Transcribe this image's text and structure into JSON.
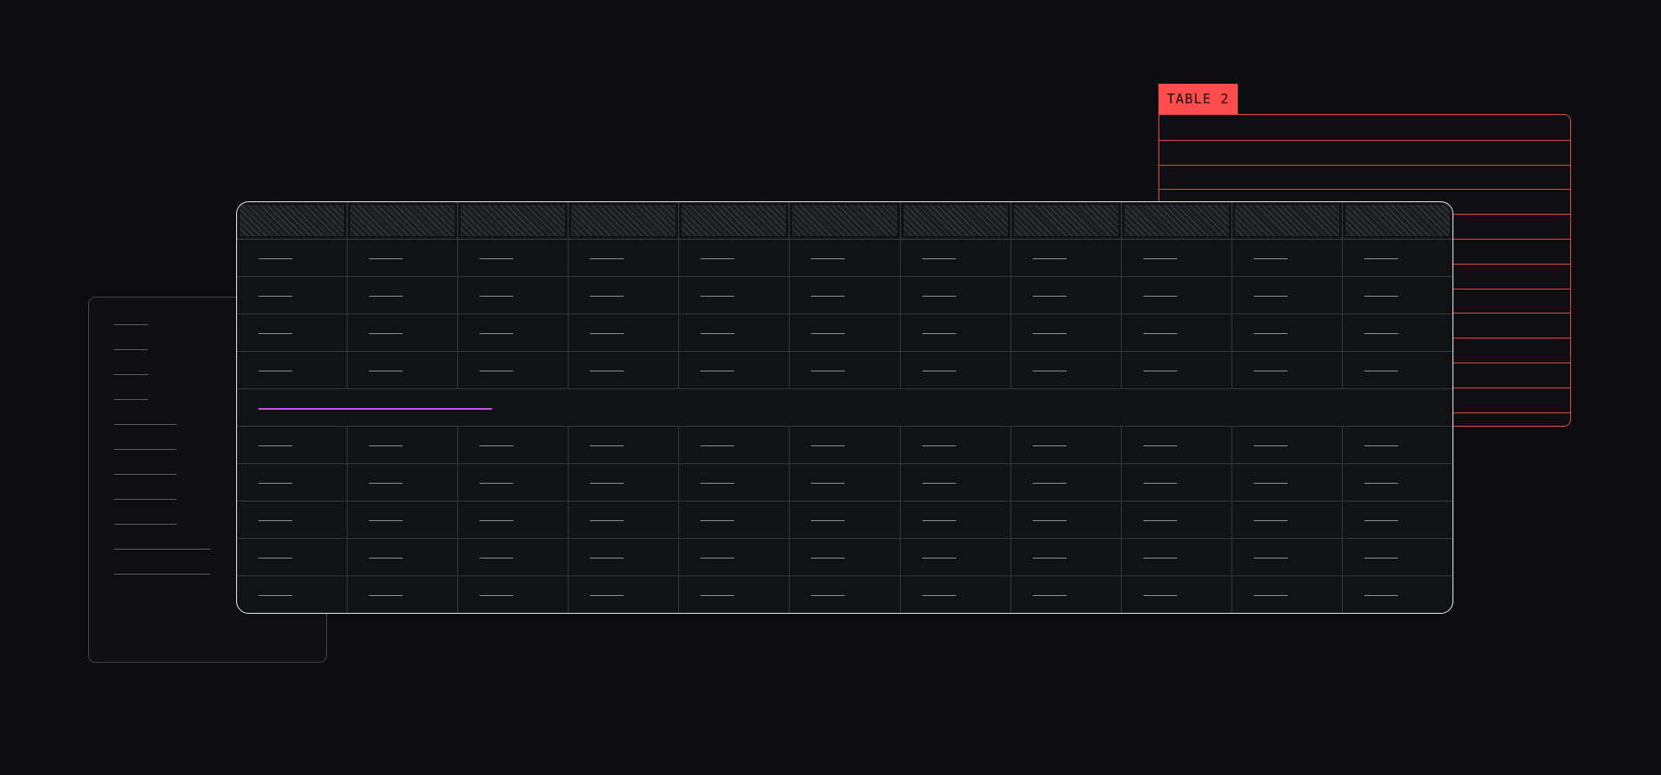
{
  "table2": {
    "label": "TABLE 2",
    "accent": "#ff4d4d",
    "row_count": 12
  },
  "main_table": {
    "columns": 11,
    "header_style": "hatched",
    "rows_before_group": 4,
    "rows_after_group": 5,
    "group_highlight_color": "#c94fe0",
    "border_color": "#e6e6e6"
  },
  "side_panel": {
    "line_count": 11
  },
  "colors": {
    "background": "#0d0d11",
    "grid": "#35363a",
    "placeholder": "#8a8a8f"
  }
}
